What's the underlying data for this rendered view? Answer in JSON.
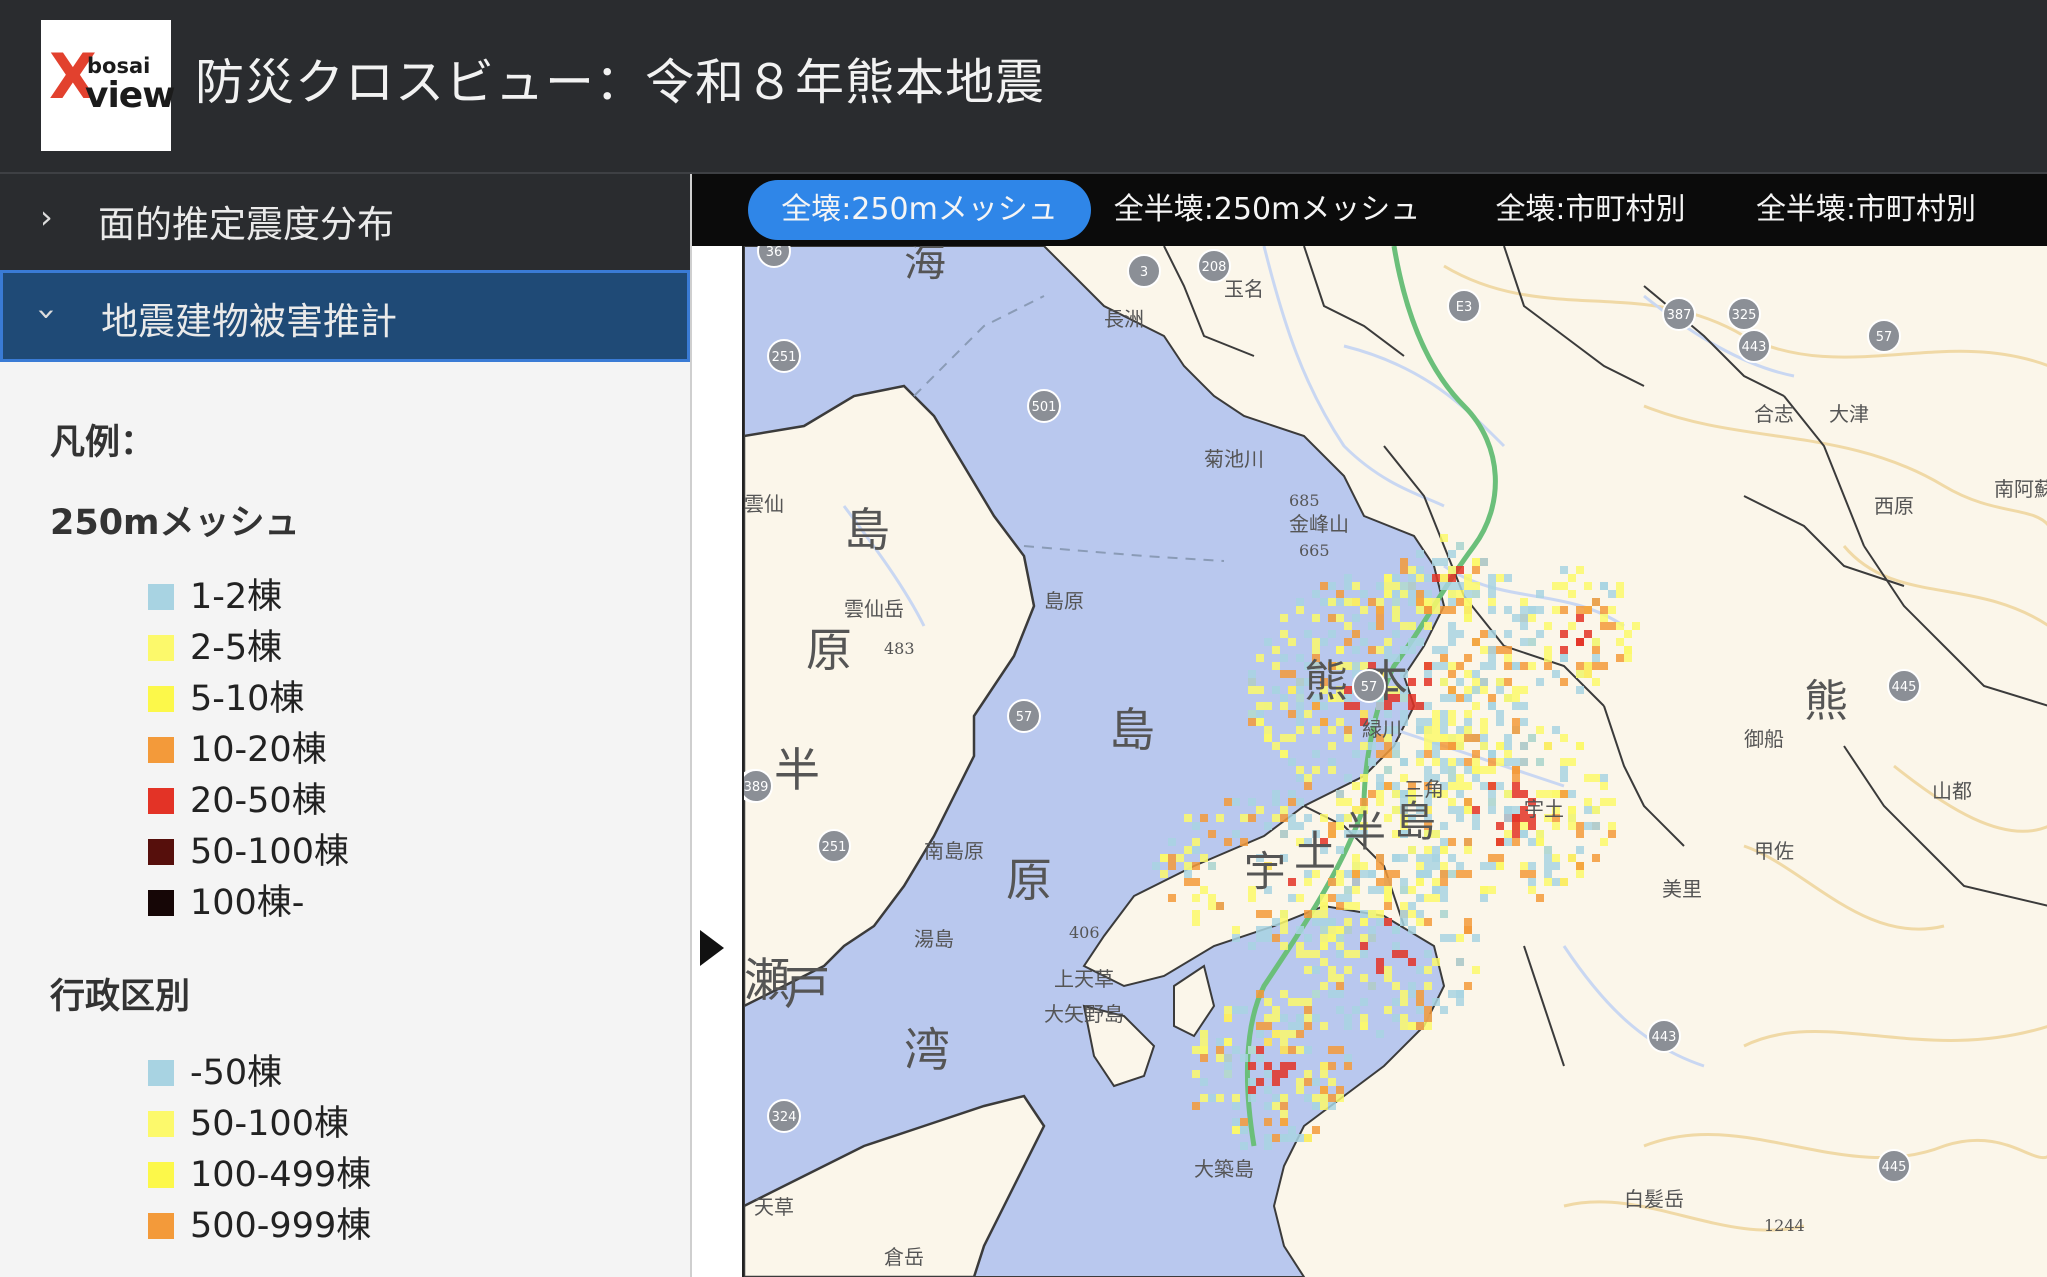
{
  "header": {
    "logo": {
      "mark": "X",
      "line1": "bosai",
      "line2": "view"
    },
    "title": "防災クロスビュー：令和８年熊本地震"
  },
  "sidebar": {
    "items": [
      {
        "label": "面的推定震度分布",
        "expanded": false
      },
      {
        "label": "地震建物被害推計",
        "expanded": true
      }
    ],
    "legend": {
      "title": "凡例：",
      "sections": [
        {
          "heading": "250mメッシュ",
          "entries": [
            {
              "label": "1-2棟",
              "color": "#a8d3e2"
            },
            {
              "label": "2-5棟",
              "color": "#fcf96b"
            },
            {
              "label": "5-10棟",
              "color": "#fcf84a"
            },
            {
              "label": "10-20棟",
              "color": "#f39a3a"
            },
            {
              "label": "20-50棟",
              "color": "#e33326"
            },
            {
              "label": "50-100棟",
              "color": "#560f0c"
            },
            {
              "label": "100棟-",
              "color": "#160606"
            }
          ]
        },
        {
          "heading": "行政区別",
          "entries": [
            {
              "label": "-50棟",
              "color": "#a8d3e2"
            },
            {
              "label": "50-100棟",
              "color": "#fcf96b"
            },
            {
              "label": "100-499棟",
              "color": "#fcf84a"
            },
            {
              "label": "500-999棟",
              "color": "#f39a3a"
            }
          ]
        }
      ]
    }
  },
  "tabs": [
    {
      "label": "全壊:250mメッシュ",
      "active": true
    },
    {
      "label": "全半壊:250mメッシュ",
      "active": false
    },
    {
      "label": "全壊:市町村別",
      "active": false
    },
    {
      "label": "全半壊:市町村別",
      "active": false
    }
  ],
  "map": {
    "labels": [
      "海",
      "島",
      "原",
      "半",
      "島",
      "原",
      "瀬",
      "戸",
      "湾",
      "熊",
      "本",
      "宇",
      "土",
      "半",
      "島",
      "熊",
      "玉名",
      "長洲",
      "合志",
      "西原",
      "菊池川",
      "雲仙",
      "島原",
      "雲仙岳",
      "南島原",
      "湯島",
      "上天草",
      "大矢野島",
      "大築島",
      "緑川",
      "甲佐",
      "美里",
      "御船",
      "山都",
      "白髪岳",
      "宇土",
      "三角",
      "倉岳",
      "天草",
      "南阿蘇",
      "大津",
      "金峰山",
      "685",
      "665",
      "483",
      "406",
      "1244"
    ],
    "route_numbers": [
      "208",
      "387",
      "325",
      "57",
      "251",
      "389",
      "501",
      "57",
      "251",
      "389",
      "57",
      "443",
      "445",
      "443",
      "445",
      "324",
      "3",
      "E3",
      "36"
    ],
    "colors": {
      "sea": "#b9c8ee",
      "land": "#fbf6ea",
      "contour": "#f0d9a6",
      "river": "#c9d7f2",
      "boundary": "#3b3b3b",
      "expressway": "#6bbf7a"
    }
  }
}
